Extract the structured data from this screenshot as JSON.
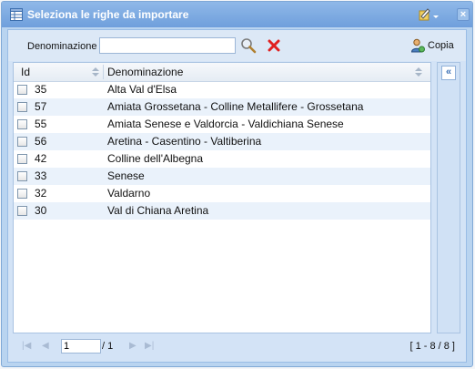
{
  "window": {
    "title": "Seleziona le righe da importare"
  },
  "toolbar": {
    "filter_label": "Denominazione",
    "filter_value": "",
    "copy_label": "Copia"
  },
  "grid": {
    "columns": [
      "Id",
      "Denominazione"
    ],
    "rows": [
      {
        "id": "35",
        "name": "Alta Val d'Elsa"
      },
      {
        "id": "57",
        "name": "Amiata Grossetana - Colline Metallifere - Grossetana"
      },
      {
        "id": "55",
        "name": "Amiata Senese e Valdorcia - Valdichiana Senese"
      },
      {
        "id": "56",
        "name": "Aretina - Casentino - Valtiberina"
      },
      {
        "id": "42",
        "name": "Colline dell'Albegna"
      },
      {
        "id": "33",
        "name": "Senese"
      },
      {
        "id": "32",
        "name": "Valdarno"
      },
      {
        "id": "30",
        "name": "Val di Chiana Aretina"
      }
    ]
  },
  "pager": {
    "page": "1",
    "total": "/ 1",
    "info": "[ 1 - 8 / 8 ]"
  },
  "colors": {
    "titlebar": "#6f9fdc",
    "row_alt": "#eaf2fb",
    "delete": "#e02020"
  }
}
